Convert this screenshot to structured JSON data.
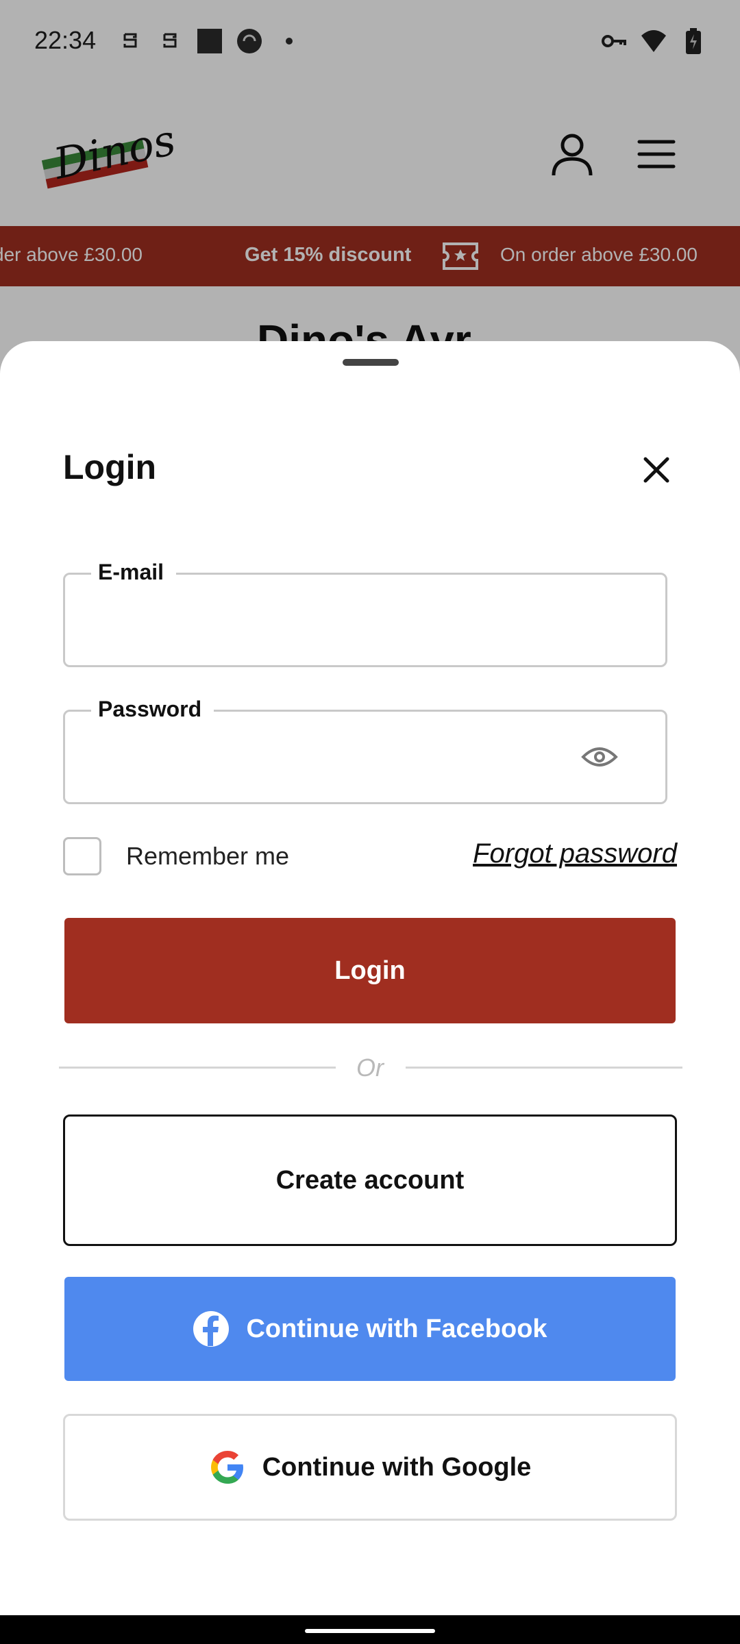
{
  "status_bar": {
    "time": "22:34",
    "left_icons": [
      "notification-s-icon",
      "notification-s-icon",
      "square-app-icon",
      "circle-app-icon",
      "dot-icon"
    ],
    "right_icons": [
      "vpn-key-icon",
      "wifi-icon",
      "battery-charging-icon"
    ]
  },
  "header": {
    "logo_text": "Dinos",
    "user_icon": "person-icon",
    "menu_icon": "hamburger-menu-icon"
  },
  "promo": {
    "item1": "der above £30.00",
    "item2": "Get 15% discount",
    "icon": "ticket-star-icon",
    "item3": "On order above £30.00"
  },
  "page": {
    "title_partial": "Dino's Ayr"
  },
  "login_sheet": {
    "title": "Login",
    "email_label": "E-mail",
    "email_value": "",
    "password_label": "Password",
    "password_value": "",
    "remember_label": "Remember me",
    "remember_checked": false,
    "forgot_label": "Forgot password",
    "login_button": "Login",
    "or_text": "Or",
    "create_account_button": "Create account",
    "facebook_button": "Continue with Facebook",
    "google_button": "Continue with Google"
  },
  "colors": {
    "brand_red": "#a02e20",
    "facebook_blue": "#4f89ee"
  }
}
